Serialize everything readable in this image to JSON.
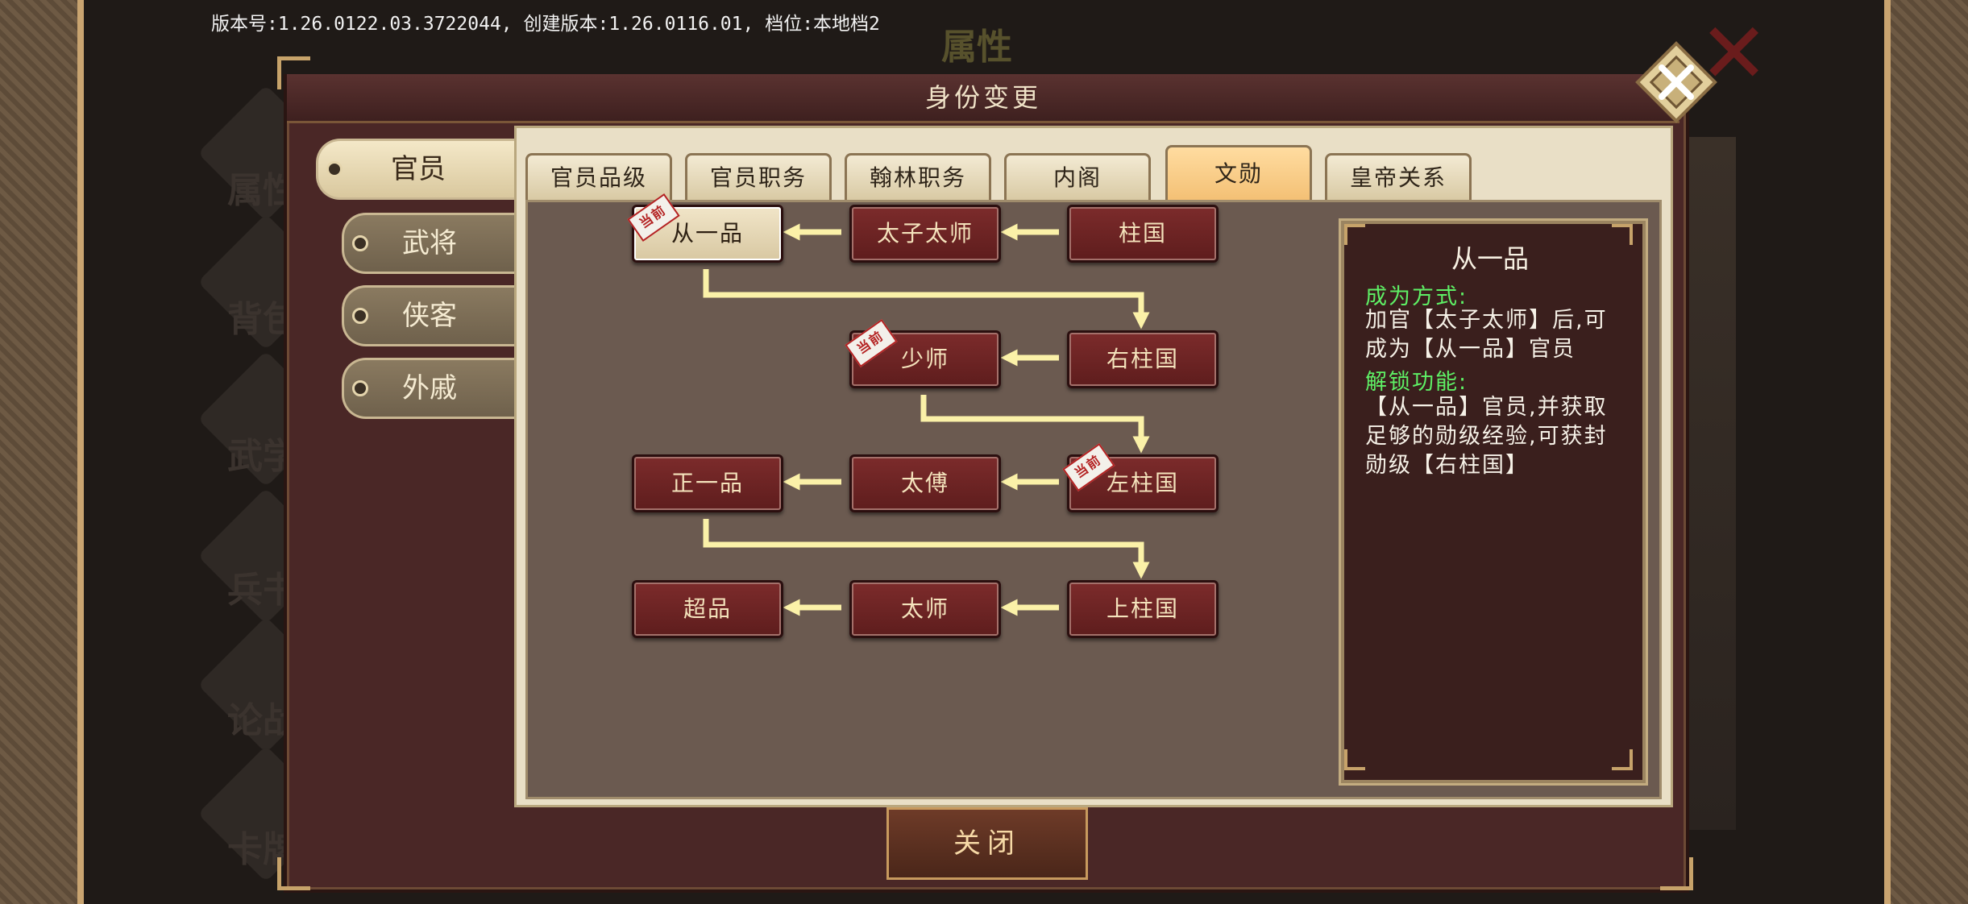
{
  "version_text": "版本号:1.26.0122.03.3722044, 创建版本:1.26.0116.01, 档位:本地档2",
  "background": {
    "title": "属性",
    "side_labels": [
      "属性",
      "背包",
      "武学",
      "兵书",
      "论战",
      "卡牌"
    ]
  },
  "window": {
    "title": "身份变更",
    "close_label": "关闭"
  },
  "categories": [
    {
      "label": "官员",
      "active": true
    },
    {
      "label": "武将",
      "active": false
    },
    {
      "label": "侠客",
      "active": false
    },
    {
      "label": "外戚",
      "active": false
    }
  ],
  "tabs": [
    {
      "label": "官员品级",
      "active": false
    },
    {
      "label": "官员职务",
      "active": false
    },
    {
      "label": "翰林职务",
      "active": false
    },
    {
      "label": "内阁",
      "active": false
    },
    {
      "label": "文勋",
      "active": true
    },
    {
      "label": "皇帝关系",
      "active": false
    }
  ],
  "flow": {
    "stamp_label": "当前",
    "rows": [
      [
        "从一品",
        "太子太师",
        "柱国"
      ],
      [
        "少师",
        "右柱国"
      ],
      [
        "正一品",
        "太傅",
        "左柱国"
      ],
      [
        "超品",
        "太师",
        "上柱国"
      ]
    ],
    "current": "从一品",
    "stamped": [
      "从一品",
      "少师",
      "左柱国"
    ]
  },
  "info": {
    "title": "从一品",
    "method_label": "成为方式:",
    "method_text": "加官【太子太师】后,可成为【从一品】官员",
    "unlock_label": "解锁功能:",
    "unlock_text": "【从一品】官员,并获取足够的勋级经验,可获封勋级【右柱国】"
  },
  "colors": {
    "accent": "#f3bf73",
    "node": "#7c2b2b",
    "arrow": "#fbf1a8",
    "label_green": "#5ef065"
  }
}
